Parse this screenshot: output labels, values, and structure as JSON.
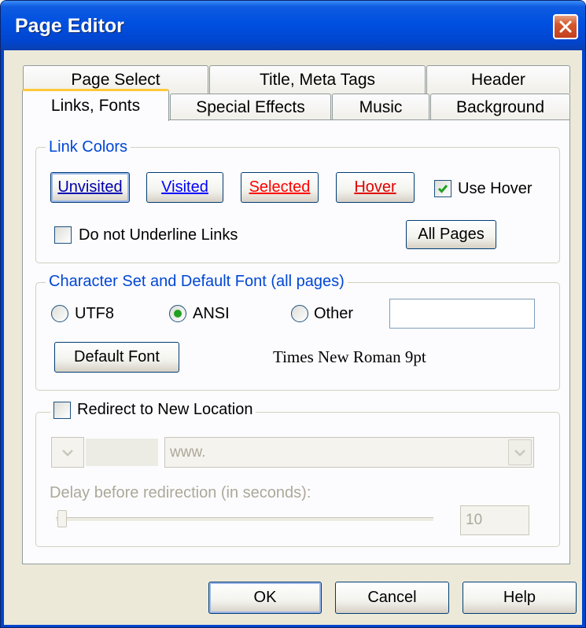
{
  "window": {
    "title": "Page Editor"
  },
  "tabs": {
    "row1": [
      {
        "label": "Page Select"
      },
      {
        "label": "Title, Meta Tags"
      },
      {
        "label": "Header"
      }
    ],
    "row2": [
      {
        "label": "Links, Fonts",
        "active": true
      },
      {
        "label": "Special Effects"
      },
      {
        "label": "Music"
      },
      {
        "label": "Background"
      }
    ]
  },
  "link_colors": {
    "legend": "Link Colors",
    "unvisited": {
      "label": "Unvisited",
      "color": "#0000b0"
    },
    "visited": {
      "label": "Visited",
      "color": "#0000ff"
    },
    "selected": {
      "label": "Selected",
      "color": "#ff0000"
    },
    "hover": {
      "label": "Hover",
      "color": "#e00000"
    },
    "use_hover": {
      "label": "Use Hover",
      "checked": true
    },
    "no_underline": {
      "label": "Do not Underline Links",
      "checked": false
    },
    "all_pages_label": "All Pages"
  },
  "charset": {
    "legend": "Character Set and Default Font (all pages)",
    "options": [
      {
        "label": "UTF8",
        "selected": false
      },
      {
        "label": "ANSI",
        "selected": true
      },
      {
        "label": "Other",
        "selected": false
      }
    ],
    "other_value": "",
    "default_font_label": "Default Font",
    "font_display": "Times New Roman  9pt"
  },
  "redirect": {
    "label": "Redirect to New Location",
    "checked": false,
    "url_value": "www.",
    "delay_label": "Delay before redirection  (in seconds):",
    "delay_value": "10"
  },
  "footer": {
    "ok_label": "OK",
    "cancel_label": "Cancel",
    "help_label": "Help"
  },
  "colors": {
    "accent_green": "#21a121",
    "legend_blue": "#0046d5",
    "titlebar_blue": "#0050e0"
  }
}
